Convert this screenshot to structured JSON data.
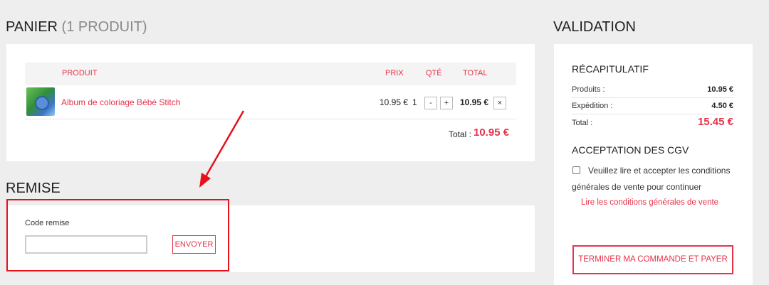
{
  "cart": {
    "title": "PANIER",
    "count_label": "(1 PRODUIT)",
    "headers": {
      "product": "PRODUIT",
      "price": "PRIX",
      "qty": "QTÉ",
      "total": "TOTAL"
    },
    "items": [
      {
        "name": "Album de coloriage Bébé Stitch",
        "price": "10.95 €",
        "qty": "1",
        "minus": "-",
        "plus": "+",
        "total": "10.95 €",
        "remove": "×"
      }
    ],
    "total_label": "Total :",
    "total_value": "10.95 €"
  },
  "remise": {
    "title": "REMISE",
    "label": "Code remise",
    "input_value": "",
    "input_placeholder": "",
    "button_label": "ENVOYER"
  },
  "validation": {
    "title": "VALIDATION",
    "recap_title": "RÉCAPITULATIF",
    "products_label": "Produits :",
    "products_value": "10.95 €",
    "shipping_label": "Expédition :",
    "shipping_value": "4.50 €",
    "total_label": "Total :",
    "total_value": "15.45 €",
    "cgv_title": "ACCEPTATION DES CGV",
    "cgv_text_line1": "Veuillez lire et accepter les conditions",
    "cgv_text_line2": "générales de vente pour continuer",
    "cgv_link": "Lire les conditions générales de vente",
    "pay_button": "TERMINER MA COMMANDE ET PAYER"
  },
  "colors": {
    "accent": "#e7324b",
    "highlight": "#e8101a",
    "background": "#eeeeee"
  },
  "annotations": {
    "arrow_icon": "arrow-down-left-icon"
  }
}
